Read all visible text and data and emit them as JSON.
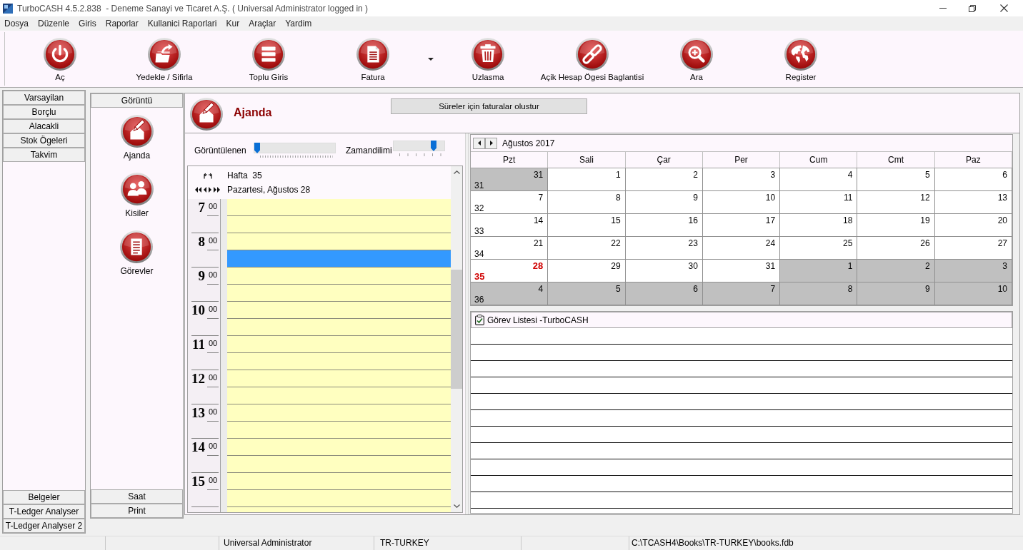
{
  "window": {
    "title": "TurboCASH 4.5.2.838  - Deneme Sanayi ve Ticaret A.Ş. ( Universal Administrator logged in )"
  },
  "menu": [
    "Dosya",
    "Düzenle",
    "Giris",
    "Raporlar",
    "Kullanici Raporlari",
    "Kur",
    "Araçlar",
    "Yardim"
  ],
  "toolbar": [
    {
      "label": "Aç",
      "kind": "power",
      "dropdown": false
    },
    {
      "label": "Yedekle / Sifirla",
      "kind": "backup",
      "dropdown": false
    },
    {
      "label": "Toplu Giris",
      "kind": "list",
      "dropdown": false
    },
    {
      "label": "Fatura",
      "kind": "invoice",
      "dropdown": true
    },
    {
      "label": "Uzlasma",
      "kind": "trash",
      "dropdown": false
    },
    {
      "label": "Açik Hesap Ögesi Baglantisi",
      "kind": "link",
      "dropdown": false
    },
    {
      "label": "Ara",
      "kind": "search",
      "dropdown": false
    },
    {
      "label": "Register",
      "kind": "globe",
      "dropdown": false
    }
  ],
  "sidebar": {
    "top_items": [
      "Varsayilan",
      "Borçlu",
      "Alacakli",
      "Stok Ögeleri",
      "Takvim"
    ],
    "bottom_items": [
      "Belgeler",
      "T-Ledger Analyser",
      "T-Ledger Analyser 2"
    ]
  },
  "views_panel": {
    "header": "Görüntü",
    "items": [
      {
        "label": "Ajanda",
        "kind": "agenda"
      },
      {
        "label": "Kisiler",
        "kind": "contacts"
      },
      {
        "label": "Görevler",
        "kind": "tasks"
      }
    ],
    "footer_items": [
      "Saat",
      "Print"
    ]
  },
  "main": {
    "title": "Ajanda",
    "kind": "agenda",
    "action_button": "Süreler için faturalar olustur"
  },
  "day_view": {
    "sliders": [
      {
        "label": "Görüntülenen",
        "kind": "fine",
        "level": 0
      },
      {
        "label": "Zamandilimi",
        "kind": "coarse",
        "level": 0.83
      }
    ],
    "week_label": "Hafta  35",
    "date_label": "Pazartesi, Ağustos 28",
    "hours": [
      {
        "hour": "7",
        "minutes": "00",
        "slots": [
          {
            "selected": false
          },
          {
            "selected": false
          }
        ]
      },
      {
        "hour": "8",
        "minutes": "00",
        "slots": [
          {
            "selected": false
          },
          {
            "selected": true
          }
        ]
      },
      {
        "hour": "9",
        "minutes": "00",
        "slots": [
          {
            "selected": false
          },
          {
            "selected": false
          }
        ]
      },
      {
        "hour": "10",
        "minutes": "00",
        "slots": [
          {
            "selected": false
          },
          {
            "selected": false
          }
        ]
      },
      {
        "hour": "11",
        "minutes": "00",
        "slots": [
          {
            "selected": false
          },
          {
            "selected": false
          }
        ]
      },
      {
        "hour": "12",
        "minutes": "00",
        "slots": [
          {
            "selected": false
          },
          {
            "selected": false
          }
        ]
      },
      {
        "hour": "13",
        "minutes": "00",
        "slots": [
          {
            "selected": false
          },
          {
            "selected": false
          }
        ]
      },
      {
        "hour": "14",
        "minutes": "00",
        "slots": [
          {
            "selected": false
          },
          {
            "selected": false
          }
        ]
      },
      {
        "hour": "15",
        "minutes": "00",
        "slots": [
          {
            "selected": false
          },
          {
            "selected": false
          }
        ]
      }
    ]
  },
  "month_calendar": {
    "title": "Ağustos 2017",
    "weekdays": [
      "Pzt",
      "Sali",
      "Çar",
      "Per",
      "Cum",
      "Cmt",
      "Paz"
    ],
    "weeks": [
      {
        "number": "31",
        "current": false,
        "days": [
          {
            "day": "31",
            "in_month": false,
            "today": false
          },
          {
            "day": "1",
            "in_month": true,
            "today": false
          },
          {
            "day": "2",
            "in_month": true,
            "today": false
          },
          {
            "day": "3",
            "in_month": true,
            "today": false
          },
          {
            "day": "4",
            "in_month": true,
            "today": false
          },
          {
            "day": "5",
            "in_month": true,
            "today": false
          },
          {
            "day": "6",
            "in_month": true,
            "today": false
          }
        ]
      },
      {
        "number": "32",
        "current": false,
        "days": [
          {
            "day": "7",
            "in_month": true,
            "today": false
          },
          {
            "day": "8",
            "in_month": true,
            "today": false
          },
          {
            "day": "9",
            "in_month": true,
            "today": false
          },
          {
            "day": "10",
            "in_month": true,
            "today": false
          },
          {
            "day": "11",
            "in_month": true,
            "today": false
          },
          {
            "day": "12",
            "in_month": true,
            "today": false
          },
          {
            "day": "13",
            "in_month": true,
            "today": false
          }
        ]
      },
      {
        "number": "33",
        "current": false,
        "days": [
          {
            "day": "14",
            "in_month": true,
            "today": false
          },
          {
            "day": "15",
            "in_month": true,
            "today": false
          },
          {
            "day": "16",
            "in_month": true,
            "today": false
          },
          {
            "day": "17",
            "in_month": true,
            "today": false
          },
          {
            "day": "18",
            "in_month": true,
            "today": false
          },
          {
            "day": "19",
            "in_month": true,
            "today": false
          },
          {
            "day": "20",
            "in_month": true,
            "today": false
          }
        ]
      },
      {
        "number": "34",
        "current": false,
        "days": [
          {
            "day": "21",
            "in_month": true,
            "today": false
          },
          {
            "day": "22",
            "in_month": true,
            "today": false
          },
          {
            "day": "23",
            "in_month": true,
            "today": false
          },
          {
            "day": "24",
            "in_month": true,
            "today": false
          },
          {
            "day": "25",
            "in_month": true,
            "today": false
          },
          {
            "day": "26",
            "in_month": true,
            "today": false
          },
          {
            "day": "27",
            "in_month": true,
            "today": false
          }
        ]
      },
      {
        "number": "35",
        "current": true,
        "days": [
          {
            "day": "28",
            "in_month": true,
            "today": true
          },
          {
            "day": "29",
            "in_month": true,
            "today": false
          },
          {
            "day": "30",
            "in_month": true,
            "today": false
          },
          {
            "day": "31",
            "in_month": true,
            "today": false
          },
          {
            "day": "1",
            "in_month": false,
            "today": false
          },
          {
            "day": "2",
            "in_month": false,
            "today": false
          },
          {
            "day": "3",
            "in_month": false,
            "today": false
          }
        ]
      },
      {
        "number": "36",
        "current": false,
        "days": [
          {
            "day": "4",
            "in_month": false,
            "today": false
          },
          {
            "day": "5",
            "in_month": false,
            "today": false
          },
          {
            "day": "6",
            "in_month": false,
            "today": false
          },
          {
            "day": "7",
            "in_month": false,
            "today": false
          },
          {
            "day": "8",
            "in_month": false,
            "today": false
          },
          {
            "day": "9",
            "in_month": false,
            "today": false
          },
          {
            "day": "10",
            "in_month": false,
            "today": false
          }
        ]
      }
    ]
  },
  "task_list": {
    "title": "Görev Listesi -TurboCASH"
  },
  "status_bar": {
    "user": "Universal Administrator",
    "locale": "TR-TURKEY",
    "database": "C:\\TCASH4\\Books\\TR-TURKEY\\books.fdb"
  }
}
